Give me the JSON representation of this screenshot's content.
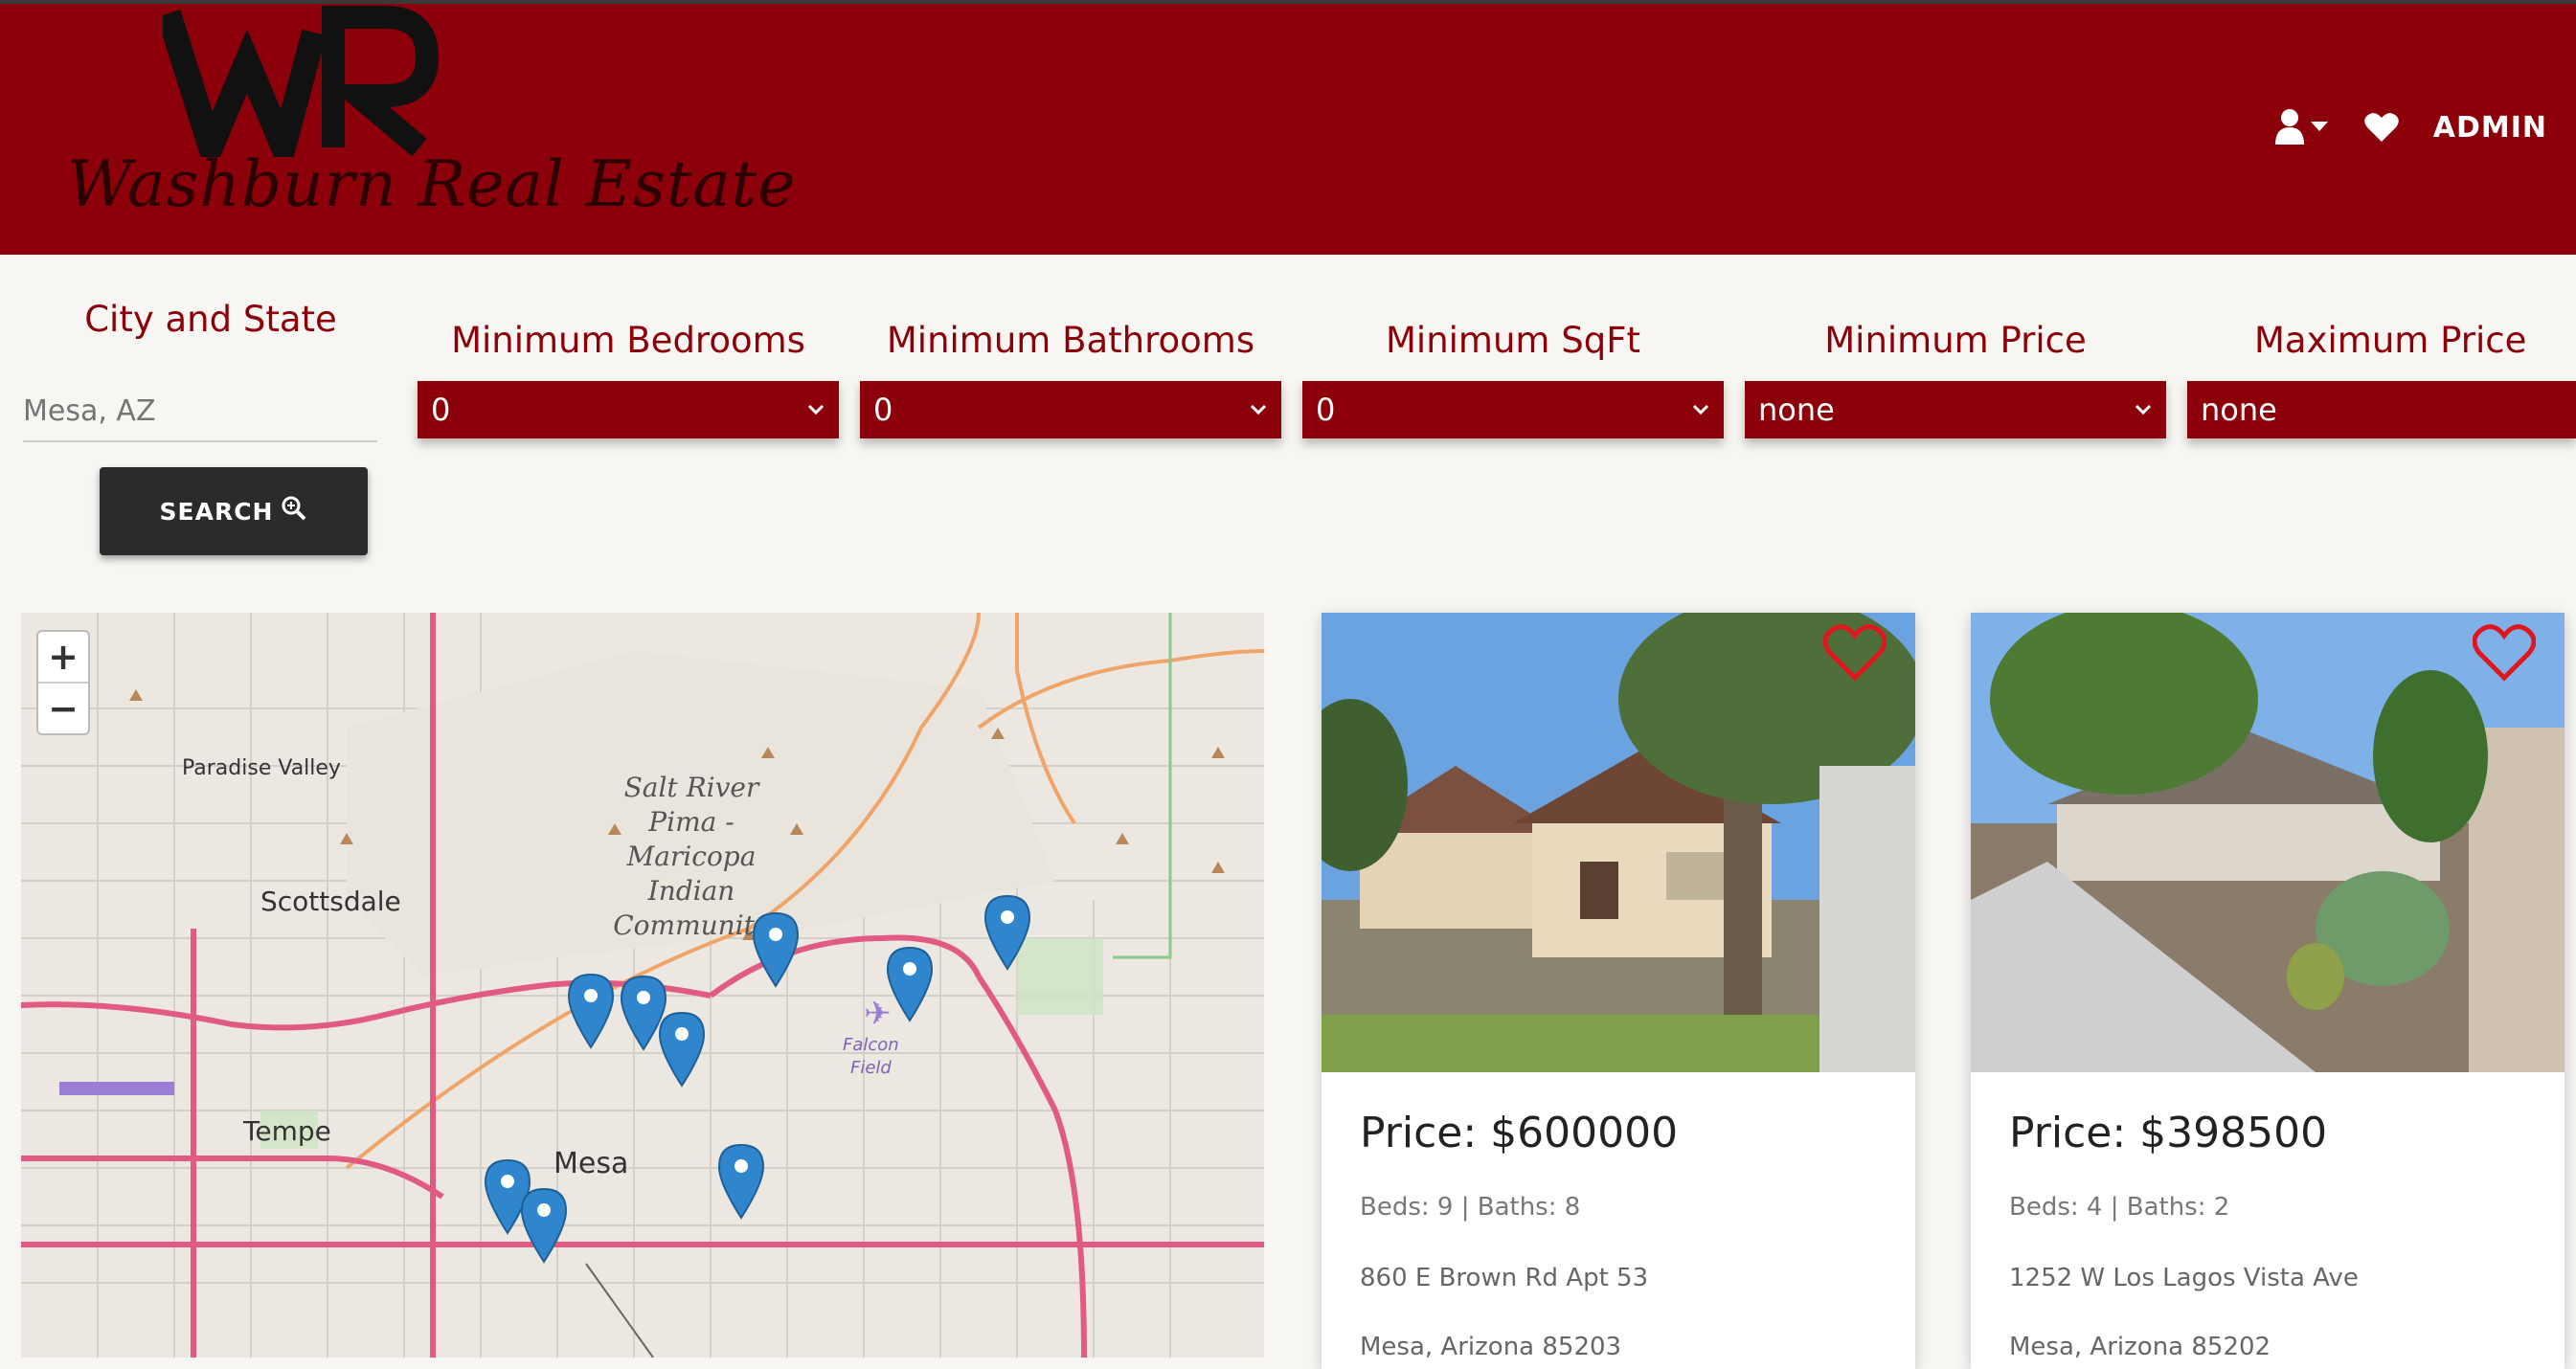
{
  "brand": {
    "logo_letters": "WR",
    "name": "Washburn Real Estate",
    "color": "#8b0009"
  },
  "nav": {
    "user_icon": "user-icon",
    "favorites_icon": "heart-icon",
    "admin_label": "ADMIN"
  },
  "filters": {
    "city_label": "City and State",
    "city_placeholder": "Mesa, AZ",
    "search_label": "SEARCH",
    "min_bedrooms": {
      "label": "Minimum Bedrooms",
      "value": "0"
    },
    "min_bathrooms": {
      "label": "Minimum Bathrooms",
      "value": "0"
    },
    "min_sqft": {
      "label": "Minimum SqFt",
      "value": "0"
    },
    "min_price": {
      "label": "Minimum Price",
      "value": "none"
    },
    "max_price": {
      "label": "Maximum Price",
      "value": "none"
    }
  },
  "map": {
    "zoom_in": "+",
    "zoom_out": "−",
    "labels": {
      "paradise_valley": "Paradise Valley",
      "scottsdale": "Scottsdale",
      "tempe": "Tempe",
      "mesa": "Mesa",
      "reservation_1": "Salt River",
      "reservation_2": "Pima -",
      "reservation_3": "Maricopa",
      "reservation_4": "Indian",
      "reservation_5": "Community",
      "falcon_1": "Falcon",
      "falcon_2": "Field"
    },
    "marker_count": 10
  },
  "listings": [
    {
      "price": "Price: $600000",
      "details": "Beds: 9 | Baths: 8",
      "address": "860 E Brown Rd Apt 53",
      "city": "Mesa, Arizona 85203"
    },
    {
      "price": "Price: $398500",
      "details": "Beds: 4 | Baths: 2",
      "address": "1252 W Los Lagos Vista Ave",
      "city": "Mesa, Arizona 85202"
    }
  ]
}
